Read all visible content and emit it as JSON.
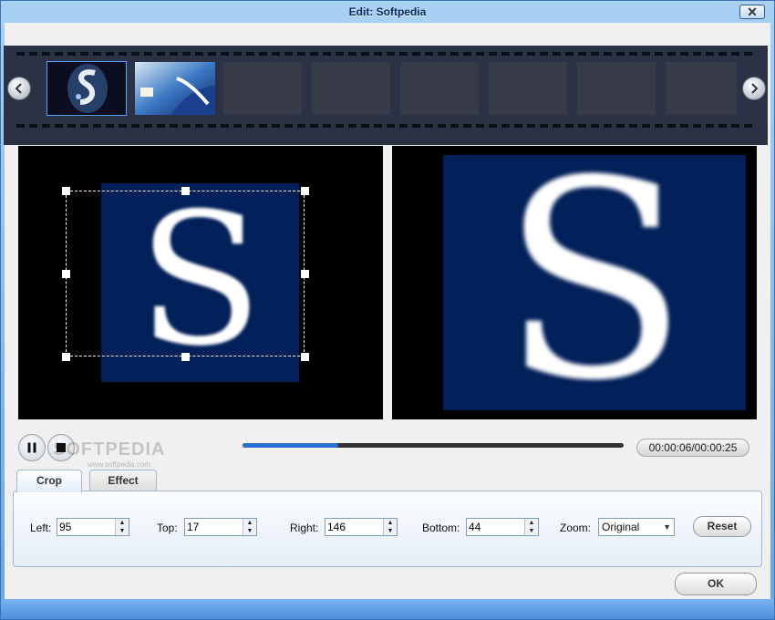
{
  "window": {
    "title": "Edit: Softpedia",
    "close_label": "✕"
  },
  "filmstrip": {
    "prev_icon": "chevron-left-icon",
    "next_icon": "chevron-right-icon",
    "thumb_count": 8,
    "selected_index": 0
  },
  "preview": {
    "original_letter": "S",
    "output_letter": "S"
  },
  "playback": {
    "time": "00:00:06/00:00:25",
    "progress_fraction": 0.25,
    "watermark": "SOFTPEDIA",
    "watermark_sub": "www.softpedia.com"
  },
  "tabs": {
    "crop_label": "Crop",
    "effect_label": "Effect"
  },
  "crop": {
    "left_label": "Left:",
    "left_value": "95",
    "top_label": "Top:",
    "top_value": "17",
    "right_label": "Right:",
    "right_value": "146",
    "bottom_label": "Bottom:",
    "bottom_value": "44",
    "zoom_label": "Zoom:",
    "zoom_value": "Original",
    "reset_label": "Reset"
  },
  "footer": {
    "ok_label": "OK"
  },
  "colors": {
    "accent": "#2a70d0",
    "film": "#2b3245",
    "preview_bg": "#022059"
  }
}
